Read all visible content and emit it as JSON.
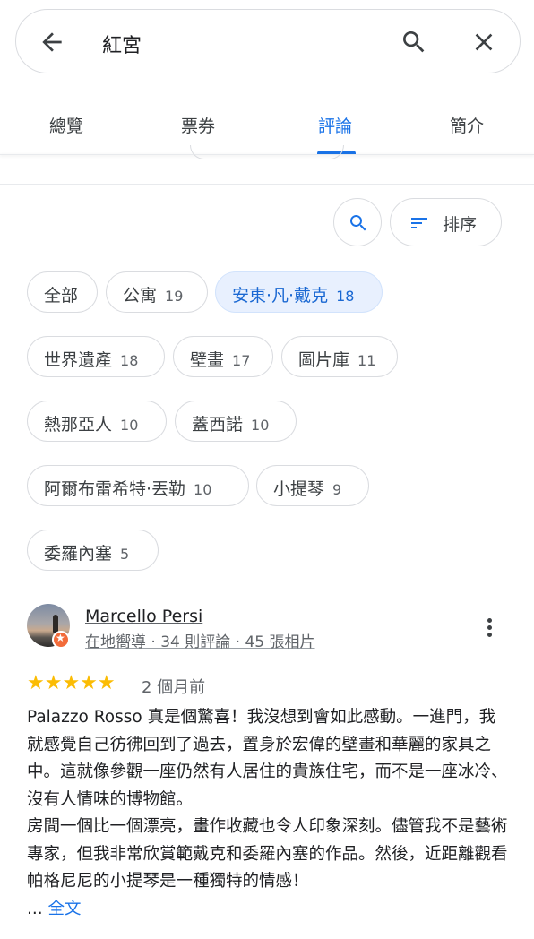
{
  "search": {
    "query": "紅宮",
    "icons": {
      "back": "arrow-back-icon",
      "search": "search-icon",
      "close": "close-icon"
    }
  },
  "tabs": [
    {
      "label": "總覽",
      "active": false
    },
    {
      "label": "票券",
      "active": false
    },
    {
      "label": "評論",
      "active": true
    },
    {
      "label": "簡介",
      "active": false
    }
  ],
  "toolbar": {
    "search_icon": "search-icon",
    "sort_icon": "sort-icon",
    "sort_label": "排序"
  },
  "chips": [
    {
      "label": "全部",
      "count": ""
    },
    {
      "label": "公寓",
      "count": "19"
    },
    {
      "label": "安東·凡·戴克",
      "count": "18",
      "selected": true
    },
    {
      "label": "世界遺產",
      "count": "18"
    },
    {
      "label": "壁畫",
      "count": "17"
    },
    {
      "label": "圖片庫",
      "count": "11"
    },
    {
      "label": "熱那亞人",
      "count": "10"
    },
    {
      "label": "蓋西諾",
      "count": "10"
    },
    {
      "label": "阿爾布雷希特·丟勒",
      "count": "10"
    },
    {
      "label": "小提琴",
      "count": "9"
    },
    {
      "label": "委羅內塞",
      "count": "5"
    }
  ],
  "review": {
    "author": "Marcello Persi",
    "meta": "在地嚮導 · 34 則評論 · 45 張相片",
    "rating": 5,
    "stars": "★★★★★",
    "when": "2 個月前",
    "text": "Palazzo Rosso 真是個驚喜！我沒想到會如此感動。一進門，我就感覺自己彷彿回到了過去，置身於宏偉的壁畫和華麗的家具之中。這就像參觀一座仍然有人居住的貴族住宅，而不是一座冰冷、沒有人情味的博物館。\n房間一個比一個漂亮，畫作收藏也令人印象深刻。儘管我不是藝術專家，但我非常欣賞範戴克和委羅內塞的作品。然後，近距離觀看帕格尼尼的小提琴是一種獨特的情感！",
    "ellipsis": "...",
    "more_label": "全文",
    "badge_icon": "local-guide-star-icon",
    "menu_icon": "more-vert-icon"
  },
  "colors": {
    "accent": "#1a73e8",
    "star": "#fbbc04",
    "chip_selected_bg": "#e8f0fe"
  }
}
